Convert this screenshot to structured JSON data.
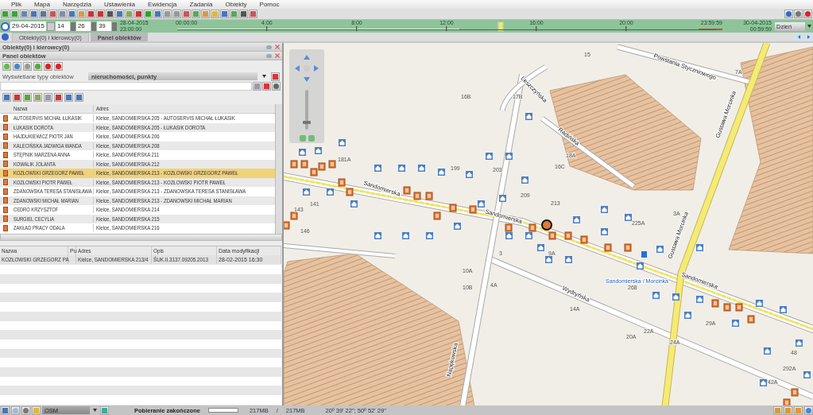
{
  "menu": [
    "Plik",
    "Mapa",
    "Narzędzia",
    "Ustawienia",
    "Ewidencja",
    "Zadania",
    "Obiekty",
    "Pomoc"
  ],
  "timeline": {
    "date": "29-04-2015",
    "hour": "14",
    "minute": "26",
    "second": "39",
    "start_date": "28-04-2015",
    "start_time": "23:00:00",
    "zero_time": "00:00:00",
    "hours": [
      "4:00",
      "8:00",
      "12:00",
      "16:00",
      "20:00"
    ],
    "end_time": "23:59:59",
    "end_date": "30-04-2015",
    "end_date_time": "00:59:59",
    "level": 0.6,
    "range": "Dzień"
  },
  "tabs": [
    {
      "label": "Obiekty(0) i kierowcy(0)",
      "selected": false
    },
    {
      "label": "Panel obiektów",
      "selected": true
    }
  ],
  "panels": [
    "Obiekty(0) i kierowcy(0)",
    "Panel obiektów"
  ],
  "filter": {
    "label": "Wyświetlane typy obiektów",
    "value": "nieruchomości, punkty"
  },
  "objects_table": {
    "columns": [
      "Nazwa",
      "Adres"
    ],
    "rows": [
      {
        "name": "AUTOSERVIS MICHAŁ ŁUKASIK",
        "address": "Kielce, SANDOMIERSKA 205 - AUTOSERVIS MICHAŁ ŁUKASIK",
        "selected": false
      },
      {
        "name": "ŁUKASIK DOROTA",
        "address": "Kielce, SANDOMIERSKA 205 - ŁUKASIK DOROTA",
        "selected": false
      },
      {
        "name": "HAJDUKIEWICZ PIOTR JAN",
        "address": "Kielce, SANDOMIERSKA 206",
        "selected": false
      },
      {
        "name": "KALECIŃSKA JADWIGA WANDA",
        "address": "Kielce, SANDOMIERSKA 208",
        "selected": false
      },
      {
        "name": "STĘPNIK MARZENA ANNA",
        "address": "Kielce, SANDOMIERSKA 211",
        "selected": false
      },
      {
        "name": "KOWALIK JOLANTA",
        "address": "Kielce, SANDOMIERSKA 212",
        "selected": false
      },
      {
        "name": "KOZŁOWSKI GRZEGORZ PAWEŁ",
        "address": "Kielce, SANDOMIERSKA 213 - KOZŁOWSKI GRZEGORZ PAWEŁ",
        "selected": true
      },
      {
        "name": "KOZŁOWSKI PIOTR PAWEŁ",
        "address": "Kielce, SANDOMIERSKA 213 - KOZŁOWSKI PIOTR PAWEŁ",
        "selected": false
      },
      {
        "name": "ZDANOWSKA TERESA STANISŁAWA",
        "address": "Kielce, SANDOMIERSKA 213 - ZDANOWSKA TERESA STANISŁAWA",
        "selected": false
      },
      {
        "name": "ZDANOWSKI MICHAŁ MARIAN",
        "address": "Kielce, SANDOMIERSKA 213 - ZDANOWSKI MICHAŁ MARIAN",
        "selected": false
      },
      {
        "name": "CEDRO KRZYSZTOF",
        "address": "Kielce, SANDOMIERSKA 214",
        "selected": false
      },
      {
        "name": "SURGIEL CECYLIA",
        "address": "Kielce, SANDOMIERSKA 215",
        "selected": false
      },
      {
        "name": "ZAKŁAD PRACY ODALA",
        "address": "Kielce, SANDOMIERSKA 216",
        "selected": false
      }
    ]
  },
  "details_table": {
    "columns": [
      "Nazwa",
      "Pu",
      "Adres",
      "Opis",
      "Data modyfikacji"
    ],
    "rows": [
      {
        "name": "KOZŁOWSKI GRZEGORZ PA",
        "address": "Kielce, SANDOMIERSKA 213/4",
        "description": "ŚUK.II.3137.09205.2013",
        "modified": "28-02-2015 16:30"
      }
    ]
  },
  "map": {
    "streets": [
      "Powstania Styczniowego",
      "Leszczyńska",
      "Radińska",
      "Gustawa Morcinka",
      "Sandomierska",
      "Sandomierska",
      "Sandomierska",
      "Wydryńska",
      "Napękowska",
      "Gustawa Morcinka"
    ],
    "house_numbers": [
      "15",
      "7A",
      "16B",
      "17B",
      "18A",
      "16C",
      "199",
      "203",
      "209",
      "213",
      "181A",
      "141",
      "143",
      "146",
      "10A",
      "10B",
      "4A",
      "3",
      "9A",
      "268",
      "225A",
      "3A",
      "29A",
      "48",
      "42A",
      "14A",
      "20A",
      "292A",
      "24A",
      "22A"
    ],
    "stop_label": "Sandomierska / Morcinka",
    "zoom": {
      "level": 0.15
    }
  },
  "status_bar": {
    "layer": "OSM",
    "message": "Pobieranie zakończone",
    "level": 1,
    "memory_used": "217MB",
    "separator": "/",
    "memory_total": "217MB",
    "coordinates": "20º 39' 22\"; 50º 52' 29\""
  }
}
